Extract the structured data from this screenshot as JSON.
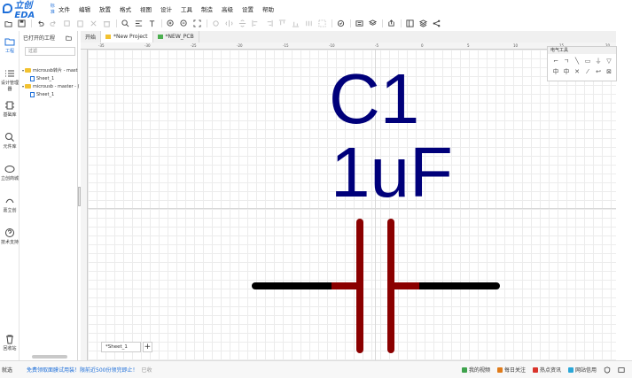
{
  "app": {
    "logo_text": "立创EDA",
    "logo_edition": "标准"
  },
  "menu": [
    "文件",
    "编辑",
    "放置",
    "格式",
    "视图",
    "设计",
    "工具",
    "制造",
    "高级",
    "设置",
    "帮助"
  ],
  "rail": [
    {
      "label": "工程",
      "icon": "project-folder-icon"
    },
    {
      "label": "设计管理器",
      "icon": "design-manager-icon"
    },
    {
      "label": "基础库",
      "icon": "basic-library-icon"
    },
    {
      "label": "元件库",
      "icon": "component-search-icon"
    },
    {
      "label": "立创商城",
      "icon": "lcsc-store-icon"
    },
    {
      "label": "嘉立创",
      "icon": "jlc-icon"
    },
    {
      "label": "技术支持",
      "icon": "support-icon"
    },
    {
      "label": "回收站",
      "icon": "trash-icon"
    }
  ],
  "panel": {
    "title": "已打开的工程",
    "filter_placeholder": "过滤",
    "tree": [
      {
        "label": "microusb转片 - mast",
        "type": "folder"
      },
      {
        "label": "Sheet_1",
        "type": "file"
      },
      {
        "label": "microusb - master - (",
        "type": "folder"
      },
      {
        "label": "Sheet_1",
        "type": "file"
      }
    ]
  },
  "tabs": [
    {
      "label": "开始",
      "type": "plain"
    },
    {
      "label": "*New Project",
      "type": "schematic"
    },
    {
      "label": "*NEW_PCB",
      "type": "pcb"
    }
  ],
  "ruler": {
    "ticks": [
      "-35",
      "-30",
      "-25",
      "-20",
      "-15",
      "-10",
      "-5",
      "0",
      "5",
      "10",
      "15",
      "20"
    ]
  },
  "schematic": {
    "designator": "C1",
    "value": "1uF"
  },
  "electrical_tools": {
    "title": "电气工具",
    "icons": [
      "wire-icon",
      "bus-icon",
      "bus-entry-icon",
      "net-label-icon",
      "net-flag-gnd-icon",
      "net-flag-vcc-icon",
      "net-port-icon",
      "no-connect-icon",
      "voltage-probe-icon",
      "pin-icon",
      "junction-icon",
      "netlabel-arrow-icon"
    ]
  },
  "sheet_tab": "*Sheet_1",
  "status": {
    "left": "就选",
    "promo": "免费领取面膜试用装！限前近500份领完即止！",
    "dim": "已收",
    "right": [
      {
        "label": "我的视频",
        "color": "#3fa34d"
      },
      {
        "label": "每日关注",
        "color": "#e07b1a"
      },
      {
        "label": "热点资讯",
        "color": "#d9342b"
      },
      {
        "label": "网站信用",
        "color": "#2aa7d8"
      }
    ]
  }
}
